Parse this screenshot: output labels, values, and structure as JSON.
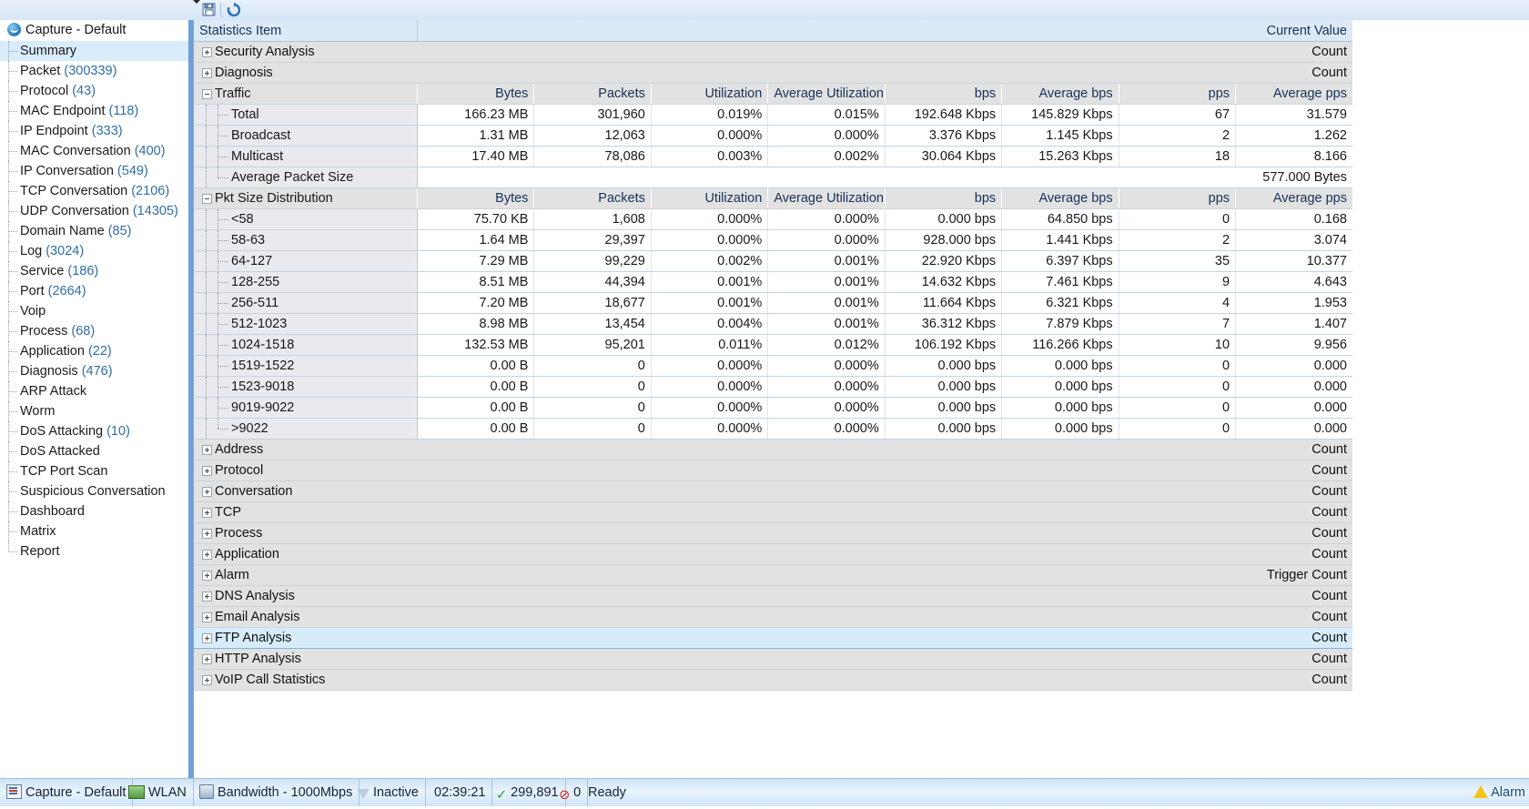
{
  "window": {
    "root_label": "Capture - Default"
  },
  "toolbar": {
    "save_icon": "save-icon",
    "refresh_icon": "refresh-icon",
    "dropdown_icon": "chevron-down-icon"
  },
  "sidebar": {
    "items": [
      {
        "label": "Summary",
        "count": "",
        "selected": true
      },
      {
        "label": "Packet",
        "count": "(300339)"
      },
      {
        "label": "Protocol",
        "count": "(43)"
      },
      {
        "label": "MAC Endpoint",
        "count": "(118)"
      },
      {
        "label": "IP Endpoint",
        "count": "(333)"
      },
      {
        "label": "MAC Conversation",
        "count": "(400)"
      },
      {
        "label": "IP Conversation",
        "count": "(549)"
      },
      {
        "label": "TCP Conversation",
        "count": "(2106)"
      },
      {
        "label": "UDP Conversation",
        "count": "(14305)"
      },
      {
        "label": "Domain Name",
        "count": "(85)"
      },
      {
        "label": "Log",
        "count": "(3024)"
      },
      {
        "label": "Service",
        "count": "(186)"
      },
      {
        "label": "Port",
        "count": "(2664)"
      },
      {
        "label": "Voip",
        "count": ""
      },
      {
        "label": "Process",
        "count": "(68)"
      },
      {
        "label": "Application",
        "count": "(22)"
      },
      {
        "label": "Diagnosis",
        "count": "(476)"
      },
      {
        "label": "ARP Attack",
        "count": ""
      },
      {
        "label": "Worm",
        "count": ""
      },
      {
        "label": "DoS Attacking",
        "count": "(10)"
      },
      {
        "label": "DoS Attacked",
        "count": ""
      },
      {
        "label": "TCP Port Scan",
        "count": ""
      },
      {
        "label": "Suspicious Conversation",
        "count": ""
      },
      {
        "label": "Dashboard",
        "count": ""
      },
      {
        "label": "Matrix",
        "count": ""
      },
      {
        "label": "Report",
        "count": ""
      }
    ]
  },
  "grid": {
    "header": {
      "item": "Statistics Item",
      "current_value": "Current Value"
    },
    "metric_headers": {
      "bytes": "Bytes",
      "packets": "Packets",
      "utilization": "Utilization",
      "avg_utilization": "Average Utilization",
      "bps": "bps",
      "avg_bps": "Average bps",
      "pps": "pps",
      "avg_pps": "Average pps"
    },
    "count_label": "Count",
    "trigger_count_label": "Trigger Count",
    "groups_top": [
      {
        "label": "Security Analysis",
        "value": "Count"
      },
      {
        "label": "Diagnosis",
        "value": "Count"
      }
    ],
    "traffic": {
      "label": "Traffic",
      "rows": [
        {
          "name": "Total",
          "bytes": "166.23 MB",
          "packets": "301,960",
          "util": "0.019%",
          "autil": "0.015%",
          "bps": "192.648 Kbps",
          "abps": "145.829 Kbps",
          "pps": "67",
          "apps": "31.579"
        },
        {
          "name": "Broadcast",
          "bytes": "1.31 MB",
          "packets": "12,063",
          "util": "0.000%",
          "autil": "0.000%",
          "bps": "3.376 Kbps",
          "abps": "1.145 Kbps",
          "pps": "2",
          "apps": "1.262"
        },
        {
          "name": "Multicast",
          "bytes": "17.40 MB",
          "packets": "78,086",
          "util": "0.003%",
          "autil": "0.002%",
          "bps": "30.064 Kbps",
          "abps": "15.263 Kbps",
          "pps": "18",
          "apps": "8.166"
        }
      ],
      "average_packet_size": {
        "name": "Average Packet Size",
        "value": "577.000 Bytes"
      }
    },
    "pkt_size_distribution": {
      "label": "Pkt Size Distribution",
      "rows": [
        {
          "name": "<58",
          "bytes": "75.70 KB",
          "packets": "1,608",
          "util": "0.000%",
          "autil": "0.000%",
          "bps": "0.000 bps",
          "abps": "64.850 bps",
          "pps": "0",
          "apps": "0.168"
        },
        {
          "name": "58-63",
          "bytes": "1.64 MB",
          "packets": "29,397",
          "util": "0.000%",
          "autil": "0.000%",
          "bps": "928.000 bps",
          "abps": "1.441 Kbps",
          "pps": "2",
          "apps": "3.074"
        },
        {
          "name": "64-127",
          "bytes": "7.29 MB",
          "packets": "99,229",
          "util": "0.002%",
          "autil": "0.001%",
          "bps": "22.920 Kbps",
          "abps": "6.397 Kbps",
          "pps": "35",
          "apps": "10.377"
        },
        {
          "name": "128-255",
          "bytes": "8.51 MB",
          "packets": "44,394",
          "util": "0.001%",
          "autil": "0.001%",
          "bps": "14.632 Kbps",
          "abps": "7.461 Kbps",
          "pps": "9",
          "apps": "4.643"
        },
        {
          "name": "256-511",
          "bytes": "7.20 MB",
          "packets": "18,677",
          "util": "0.001%",
          "autil": "0.001%",
          "bps": "11.664 Kbps",
          "abps": "6.321 Kbps",
          "pps": "4",
          "apps": "1.953"
        },
        {
          "name": "512-1023",
          "bytes": "8.98 MB",
          "packets": "13,454",
          "util": "0.004%",
          "autil": "0.001%",
          "bps": "36.312 Kbps",
          "abps": "7.879 Kbps",
          "pps": "7",
          "apps": "1.407"
        },
        {
          "name": "1024-1518",
          "bytes": "132.53 MB",
          "packets": "95,201",
          "util": "0.011%",
          "autil": "0.012%",
          "bps": "106.192 Kbps",
          "abps": "116.266 Kbps",
          "pps": "10",
          "apps": "9.956"
        },
        {
          "name": "1519-1522",
          "bytes": "0.00 B",
          "packets": "0",
          "util": "0.000%",
          "autil": "0.000%",
          "bps": "0.000 bps",
          "abps": "0.000 bps",
          "pps": "0",
          "apps": "0.000"
        },
        {
          "name": "1523-9018",
          "bytes": "0.00 B",
          "packets": "0",
          "util": "0.000%",
          "autil": "0.000%",
          "bps": "0.000 bps",
          "abps": "0.000 bps",
          "pps": "0",
          "apps": "0.000"
        },
        {
          "name": "9019-9022",
          "bytes": "0.00 B",
          "packets": "0",
          "util": "0.000%",
          "autil": "0.000%",
          "bps": "0.000 bps",
          "abps": "0.000 bps",
          "pps": "0",
          "apps": "0.000"
        },
        {
          "name": ">9022",
          "bytes": "0.00 B",
          "packets": "0",
          "util": "0.000%",
          "autil": "0.000%",
          "bps": "0.000 bps",
          "abps": "0.000 bps",
          "pps": "0",
          "apps": "0.000"
        }
      ]
    },
    "groups_bottom": [
      {
        "label": "Address",
        "value": "Count",
        "selected": false
      },
      {
        "label": "Protocol",
        "value": "Count",
        "selected": false
      },
      {
        "label": "Conversation",
        "value": "Count",
        "selected": false
      },
      {
        "label": "TCP",
        "value": "Count",
        "selected": false
      },
      {
        "label": "Process",
        "value": "Count",
        "selected": false
      },
      {
        "label": "Application",
        "value": "Count",
        "selected": false
      },
      {
        "label": "Alarm",
        "value": "Trigger Count",
        "selected": false
      },
      {
        "label": "DNS Analysis",
        "value": "Count",
        "selected": false
      },
      {
        "label": "Email Analysis",
        "value": "Count",
        "selected": false
      },
      {
        "label": "FTP Analysis",
        "value": "Count",
        "selected": true
      },
      {
        "label": "HTTP Analysis",
        "value": "Count",
        "selected": false
      },
      {
        "label": "VoIP Call Statistics",
        "value": "Count",
        "selected": false
      }
    ]
  },
  "statusbar": {
    "capture": "Capture - Default",
    "adapter": "WLAN",
    "bandwidth": "Bandwidth - 1000Mbps",
    "filter": "Inactive",
    "elapsed": "02:39:21",
    "accepted": "299,891",
    "rejected": "0",
    "state": "Ready",
    "alarm": "Alarm"
  },
  "colors": {
    "selection": "#d9ecfb",
    "header": "#dce9f6",
    "group_row": "#e2e2e2",
    "tree_cell": "#eaeaee",
    "accent": "#6f9fd8",
    "count_text": "#2f6ea5"
  }
}
